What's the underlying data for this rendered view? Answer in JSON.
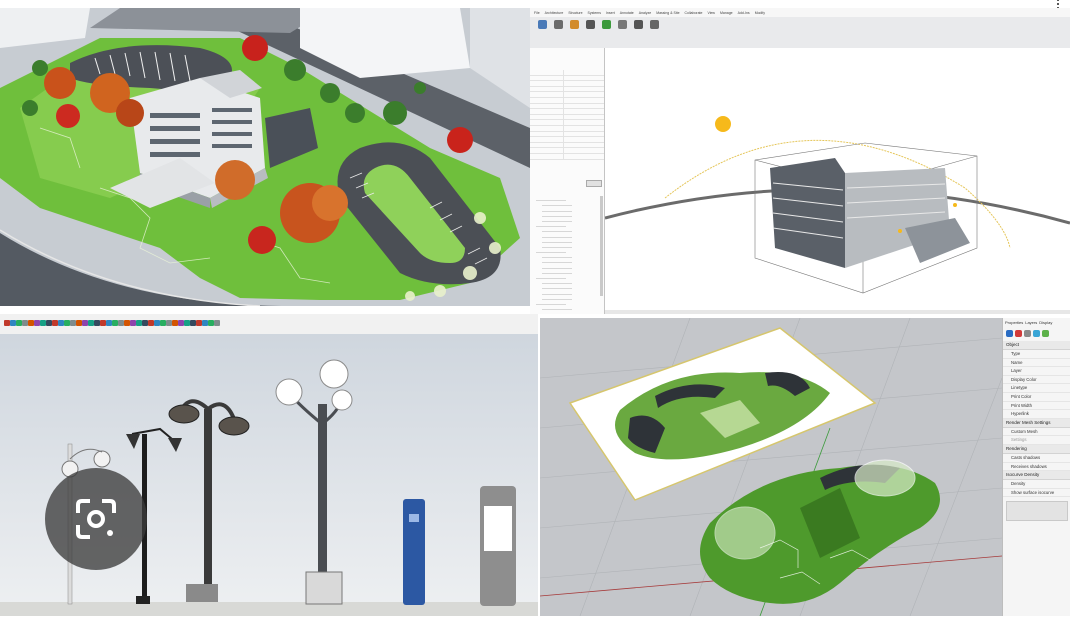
{
  "window": {
    "more_icon": "vertical-ellipsis-icon"
  },
  "render_view": {
    "description_icon": "none"
  },
  "revit": {
    "ribbon_tabs": [
      "File",
      "Architecture",
      "Structure",
      "Systems",
      "Insert",
      "Annotate",
      "Analyze",
      "Massing & Site",
      "Collaborate",
      "View",
      "Manage",
      "Add-Ins",
      "Modify"
    ],
    "properties_rows": 16,
    "browser_rows": 26
  },
  "sketchup": {
    "toolbar_icons": 36
  },
  "rhino": {
    "panel_tabs": [
      "Properties",
      "Layers",
      "Display"
    ],
    "sections": [
      {
        "title": "Object",
        "rows": [
          "Type",
          "Name",
          "Layer",
          "Display Color",
          "Linetype",
          "Print Color",
          "Print Width",
          "Hyperlink"
        ]
      },
      {
        "title": "Render Mesh Settings",
        "rows": [
          "Custom Mesh",
          "Settings"
        ]
      },
      {
        "title": "Rendering",
        "rows": [
          "Casts shadows",
          "Receives shadows"
        ]
      },
      {
        "title": "Isocurve Density",
        "rows": [
          "Density",
          "Show surface isocurve"
        ]
      }
    ]
  },
  "lens": {
    "icon": "google-lens-camera-icon"
  }
}
